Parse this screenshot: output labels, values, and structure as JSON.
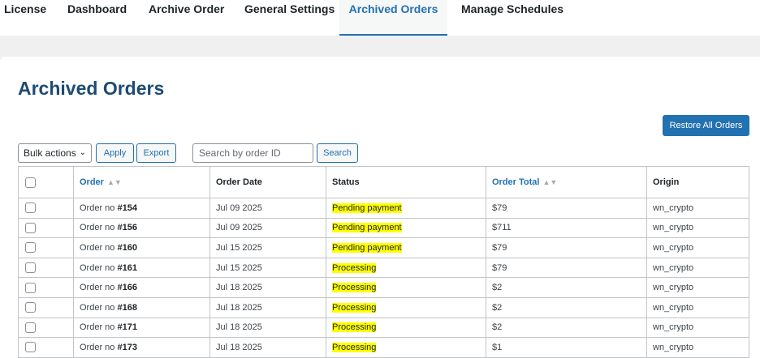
{
  "tabs": [
    {
      "label": "License"
    },
    {
      "label": "Dashboard"
    },
    {
      "label": "Archive Order"
    },
    {
      "label": "General Settings"
    },
    {
      "label": "Archived Orders",
      "active": true
    },
    {
      "label": "Manage Schedules"
    }
  ],
  "page": {
    "title": "Archived Orders"
  },
  "toolbar": {
    "restore_all_label": "Restore All Orders",
    "bulk_actions_label": "Bulk actions",
    "apply_label": "Apply",
    "export_label": "Export",
    "search_placeholder": "Search by order ID",
    "search_button_label": "Search"
  },
  "table": {
    "headers": {
      "order": "Order",
      "order_date": "Order Date",
      "status": "Status",
      "order_total": "Order Total",
      "origin": "Origin"
    },
    "order_prefix": "Order no",
    "rows": [
      {
        "number": "#154",
        "date": "Jul 09 2025",
        "status": "Pending payment",
        "total": "$79",
        "origin": "wn_crypto"
      },
      {
        "number": "#156",
        "date": "Jul 09 2025",
        "status": "Pending payment",
        "total": "$711",
        "origin": "wn_crypto"
      },
      {
        "number": "#160",
        "date": "Jul 15 2025",
        "status": "Pending payment",
        "total": "$79",
        "origin": "wn_crypto"
      },
      {
        "number": "#161",
        "date": "Jul 15 2025",
        "status": "Processing",
        "total": "$79",
        "origin": "wn_crypto"
      },
      {
        "number": "#166",
        "date": "Jul 18 2025",
        "status": "Processing",
        "total": "$2",
        "origin": "wn_crypto"
      },
      {
        "number": "#168",
        "date": "Jul 18 2025",
        "status": "Processing",
        "total": "$2",
        "origin": "wn_crypto"
      },
      {
        "number": "#171",
        "date": "Jul 18 2025",
        "status": "Processing",
        "total": "$2",
        "origin": "wn_crypto"
      },
      {
        "number": "#173",
        "date": "Jul 18 2025",
        "status": "Processing",
        "total": "$1",
        "origin": "wn_crypto"
      }
    ]
  },
  "colors": {
    "accent": "#2271b1",
    "title": "#1d4b73",
    "status_highlight": "#ffff00"
  }
}
